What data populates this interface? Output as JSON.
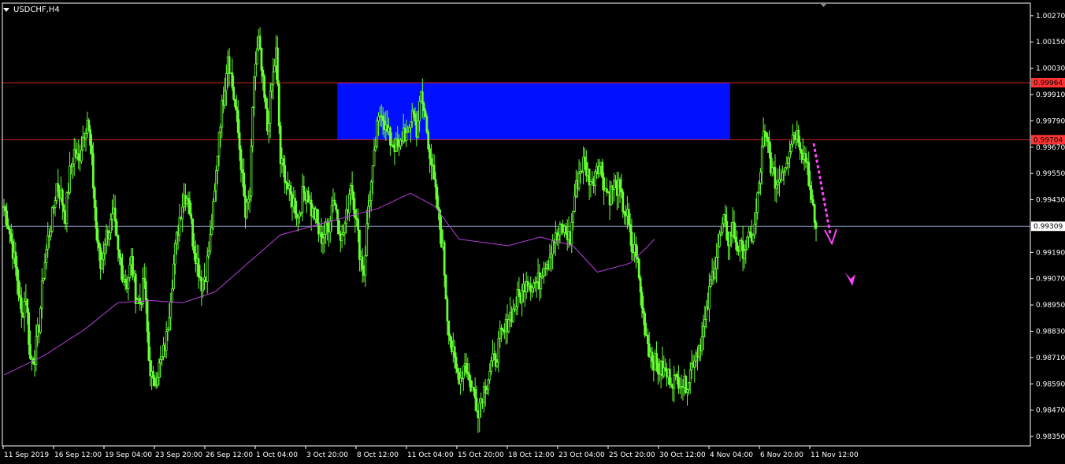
{
  "window": {
    "title": "USDCHF,H4",
    "menu_icon": "triangle-down-icon",
    "scroll_marker_icon": "triangle-down-icon"
  },
  "colors": {
    "background": "#000000",
    "frame": "#ffffff",
    "candle": "#66ff33",
    "moving_average": "#b23ed8",
    "resistance_line": "#cc2222",
    "current_price_line": "#8899bb",
    "zone_fill": "#0010ff",
    "arrow": "#ff44ff",
    "tag_red": "#ff3333",
    "tag_white": "#ffffff"
  },
  "chart_data": {
    "type": "candlestick",
    "symbol": "USDCHF",
    "timeframe": "H4",
    "y_ticks": [
      "1.00270",
      "1.00150",
      "1.00030",
      "0.99910",
      "0.99790",
      "0.99670",
      "0.99550",
      "0.99430",
      "0.99190",
      "0.99070",
      "0.98950",
      "0.98830",
      "0.98710",
      "0.98590",
      "0.98470",
      "0.98350"
    ],
    "ylim": [
      0.9832,
      1.0036
    ],
    "x_labels": [
      "11 Sep 2019",
      "16 Sep 12:00",
      "19 Sep 04:00",
      "23 Sep 20:00",
      "26 Sep 12:00",
      "1 Oct 04:00",
      "3 Oct 20:00",
      "8 Oct 12:00",
      "11 Oct 04:00",
      "15 Oct 20:00",
      "18 Oct 12:00",
      "23 Oct 04:00",
      "25 Oct 20:00",
      "30 Oct 12:00",
      "4 Nov 04:00",
      "6 Nov 20:00",
      "11 Nov 12:00"
    ],
    "close_path": [
      [
        0.994,
        0.9932
      ],
      [
        0.992,
        0.9907
      ],
      [
        0.989,
        0.99
      ],
      [
        0.987,
        0.9872
      ],
      [
        0.9886,
        0.991
      ],
      [
        0.9925,
        0.9935
      ],
      [
        0.995,
        0.9945
      ],
      [
        0.9936,
        0.9955
      ],
      [
        0.9965,
        0.996
      ],
      [
        0.9972,
        0.998
      ],
      [
        0.996,
        0.993
      ],
      [
        0.9912,
        0.9925
      ],
      [
        0.993,
        0.9935
      ],
      [
        0.9918,
        0.991
      ],
      [
        0.9905,
        0.9915
      ],
      [
        0.99,
        0.9896
      ],
      [
        0.9906,
        0.987
      ],
      [
        0.9858,
        0.9865
      ],
      [
        0.987,
        0.988
      ],
      [
        0.99,
        0.992
      ],
      [
        0.9935,
        0.9945
      ],
      [
        0.9945,
        0.9925
      ],
      [
        0.9915,
        0.9905
      ],
      [
        0.991,
        0.9925
      ],
      [
        0.9945,
        0.9975
      ],
      [
        0.999,
        1.001
      ],
      [
        0.9995,
        0.998
      ],
      [
        0.996,
        0.9935
      ],
      [
        0.9945,
        1.0
      ],
      [
        1.0015,
        0.9995
      ],
      [
        0.9975,
        0.9995
      ],
      [
        1.001,
        0.996
      ],
      [
        0.9955,
        0.9945
      ],
      [
        0.9942,
        0.9935
      ],
      [
        0.9945,
        0.9948
      ],
      [
        0.9938,
        0.9935
      ],
      [
        0.9925,
        0.9928
      ],
      [
        0.9932,
        0.9945
      ],
      [
        0.9935,
        0.9925
      ],
      [
        0.9935,
        0.9952
      ],
      [
        0.9938,
        0.992
      ],
      [
        0.991,
        0.994
      ],
      [
        0.9955,
        0.9975
      ],
      [
        0.9985,
        0.9975
      ],
      [
        0.997,
        0.9968
      ],
      [
        0.9965,
        0.9975
      ],
      [
        0.997,
        0.9985
      ],
      [
        0.9975,
        0.999
      ],
      [
        0.998,
        0.9965
      ],
      [
        0.995,
        0.9935
      ],
      [
        0.992,
        0.989
      ],
      [
        0.9875,
        0.9865
      ],
      [
        0.9862,
        0.987
      ],
      [
        0.986,
        0.9855
      ],
      [
        0.9848,
        0.9855
      ],
      [
        0.986,
        0.9868
      ],
      [
        0.987,
        0.988
      ],
      [
        0.9882,
        0.989
      ],
      [
        0.9892,
        0.9898
      ],
      [
        0.99,
        0.9908
      ],
      [
        0.9905,
        0.9905
      ],
      [
        0.9906,
        0.9915
      ],
      [
        0.9915,
        0.9925
      ],
      [
        0.9925,
        0.993
      ],
      [
        0.9928,
        0.9925
      ],
      [
        0.9945,
        0.9955
      ],
      [
        0.996,
        0.9955
      ],
      [
        0.995,
        0.996
      ],
      [
        0.9958,
        0.9948
      ],
      [
        0.9945,
        0.995
      ],
      [
        0.9948,
        0.994
      ],
      [
        0.9935,
        0.992
      ],
      [
        0.992,
        0.99
      ],
      [
        0.9885,
        0.9875
      ],
      [
        0.987,
        0.9866
      ],
      [
        0.9865,
        0.9863
      ],
      [
        0.9862,
        0.986
      ],
      [
        0.9862,
        0.9858
      ],
      [
        0.9862,
        0.987
      ],
      [
        0.9875,
        0.988
      ],
      [
        0.989,
        0.9905
      ],
      [
        0.9915,
        0.9925
      ],
      [
        0.9932,
        0.9925
      ],
      [
        0.993,
        0.9922
      ],
      [
        0.992,
        0.9922
      ],
      [
        0.9925,
        0.993
      ],
      [
        0.995,
        0.9972
      ],
      [
        0.9968,
        0.9955
      ],
      [
        0.995,
        0.9955
      ],
      [
        0.996,
        0.9968
      ],
      [
        0.9975,
        0.9972
      ],
      [
        0.9965,
        0.996
      ],
      [
        0.994,
        0.993
      ]
    ],
    "moving_average": [
      [
        0,
        0.9863
      ],
      [
        0.05,
        0.9872
      ],
      [
        0.1,
        0.9884
      ],
      [
        0.14,
        0.9896
      ],
      [
        0.18,
        0.9897
      ],
      [
        0.22,
        0.9896
      ],
      [
        0.26,
        0.9901
      ],
      [
        0.3,
        0.9914
      ],
      [
        0.34,
        0.9927
      ],
      [
        0.4,
        0.9933
      ],
      [
        0.46,
        0.9939
      ],
      [
        0.5,
        0.9946
      ],
      [
        0.53,
        0.994
      ],
      [
        0.56,
        0.9925
      ],
      [
        0.62,
        0.9922
      ],
      [
        0.66,
        0.9926
      ],
      [
        0.7,
        0.9922
      ],
      [
        0.73,
        0.991
      ],
      [
        0.77,
        0.9914
      ],
      [
        0.79,
        0.9921
      ],
      [
        0.8,
        0.9925
      ]
    ],
    "zone": {
      "label_top": "0.99964",
      "label_bottom": "0.99704",
      "high": 0.99964,
      "low": 0.99704,
      "x_start": 0.388,
      "x_end": 0.845
    },
    "levels": [
      {
        "value": 0.99964,
        "label": "0.99964"
      },
      {
        "value": 0.99704,
        "label": "0.99704"
      }
    ],
    "current_price": {
      "value": 0.99309,
      "label": "0.99309"
    }
  }
}
